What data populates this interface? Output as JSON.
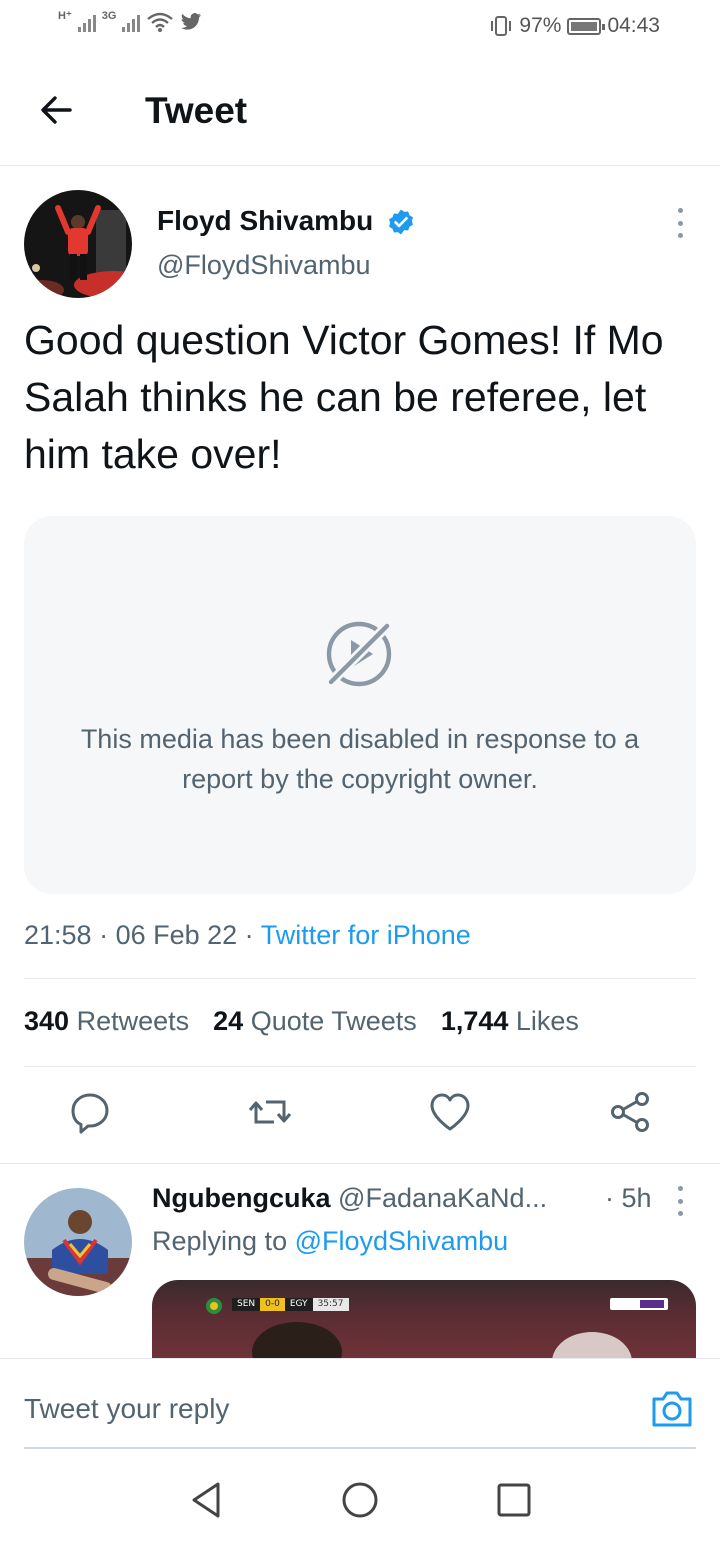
{
  "status_bar": {
    "network_1": "H⁺",
    "network_2": "3G",
    "battery": "97%",
    "battery_level": 0.97,
    "time": "04:43"
  },
  "header": {
    "title": "Tweet",
    "back_icon": "arrow-left-icon"
  },
  "tweet": {
    "author_name": "Floyd Shivambu",
    "author_handle": "@FloydShivambu",
    "verified": true,
    "text": "Good question Victor Gomes! If Mo Salah thinks he can be referee, let him take over!",
    "media_disabled_message": "This media has been disabled in response to a report by the copyright owner.",
    "time": "21:58",
    "date": "06 Feb 22",
    "source": "Twitter for iPhone",
    "separator": " · ",
    "stats": {
      "retweets_count": "340",
      "retweets_label": "Retweets",
      "quotes_count": "24",
      "quotes_label": "Quote Tweets",
      "likes_count": "1,744",
      "likes_label": "Likes"
    },
    "actions": [
      "reply-icon",
      "retweet-icon",
      "like-icon",
      "share-icon"
    ]
  },
  "reply": {
    "author_name": "Ngubengcuka",
    "author_handle": "@FadanaKaNd...",
    "time": "· 5h",
    "replying_prefix": "Replying to",
    "replying_to": "@FloydShivambu",
    "scorebug": {
      "team_1": "SEN",
      "score": "0-0",
      "team_2": "EGY",
      "clock": "35:57"
    }
  },
  "composer": {
    "placeholder": "Tweet your reply",
    "camera_icon": "camera-icon"
  },
  "nav": [
    "back-triangle-icon",
    "home-circle-icon",
    "recents-square-icon"
  ],
  "colors": {
    "accent": "#1d9bf0",
    "text_primary": "#0f1419",
    "text_secondary": "#536471",
    "media_bg": "#f5f7f8"
  }
}
